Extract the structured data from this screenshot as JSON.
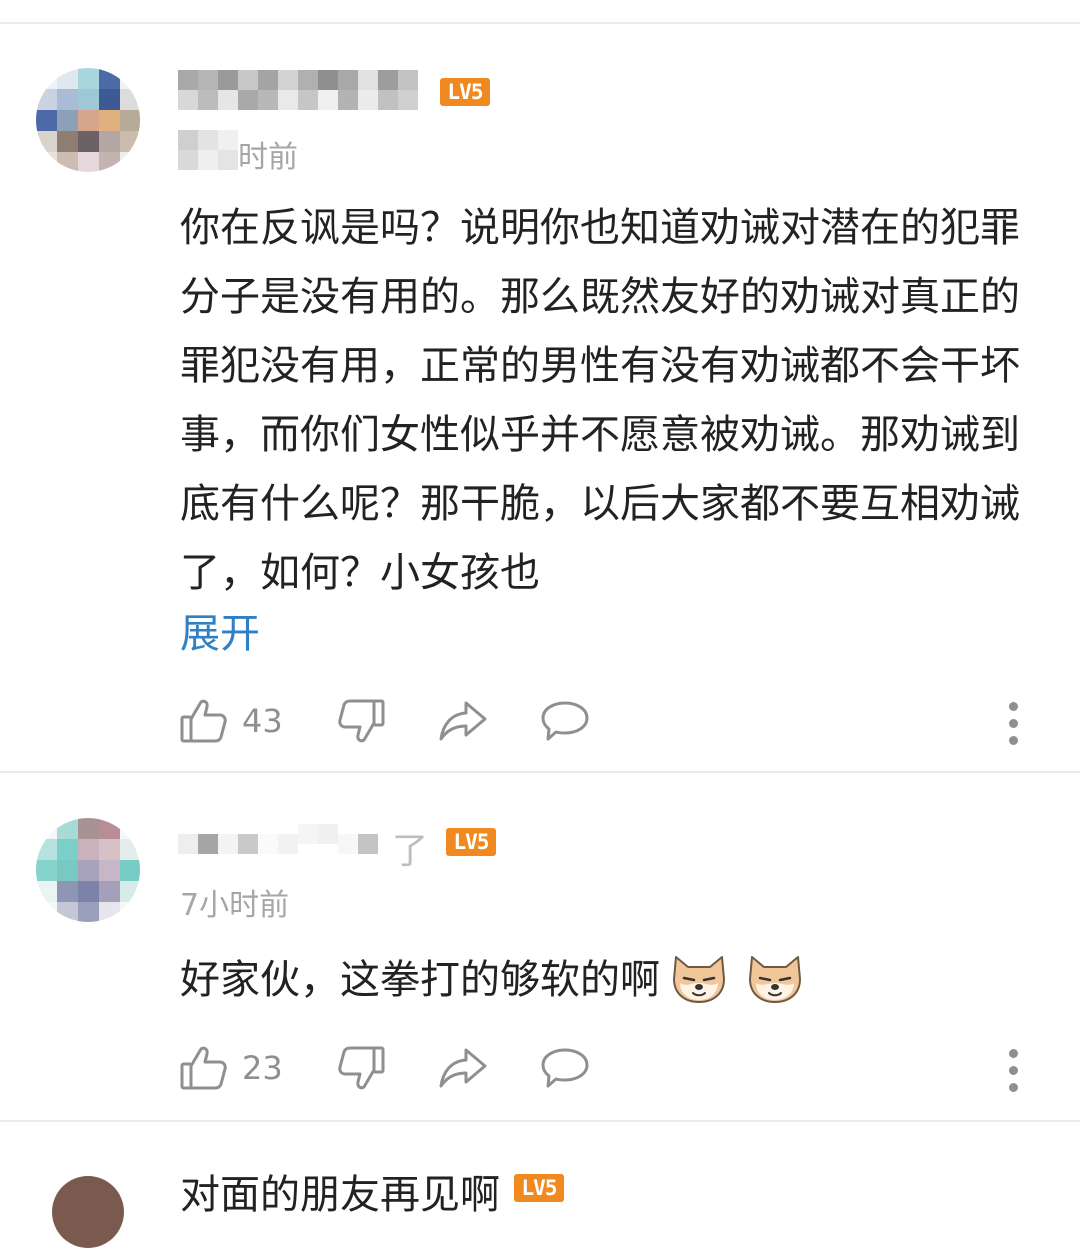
{
  "comments": [
    {
      "level_badge": "LV5",
      "time_suffix": "时前",
      "text": "你在反讽是吗？说明你也知道劝诫对潜在的犯罪分子是没有用的。那么既然友好的劝诫对真正的罪犯没有用，正常的男性有没有劝诫都不会干坏事，而你们女性似乎并不愿意被劝诫。那劝诫到底有什么呢？那干脆，以后大家都不要互相劝诫了，如何？小女孩也",
      "expand_label": "展开",
      "like_count": "43",
      "icons": [
        "thumbs-up-icon",
        "thumbs-down-icon",
        "share-icon",
        "comment-icon",
        "more-icon"
      ]
    },
    {
      "name_visible_suffix": "了",
      "level_badge": "LV5",
      "time": "7小时前",
      "text": "好家伙，这拳打的够软的啊",
      "emojis": [
        "doge-icon",
        "doge-icon"
      ],
      "like_count": "23",
      "icons": [
        "thumbs-up-icon",
        "thumbs-down-icon",
        "share-icon",
        "comment-icon",
        "more-icon"
      ]
    }
  ],
  "next_comment_partial": {
    "name": "对面的朋友再见啊",
    "level_badge": "LV5"
  },
  "colors": {
    "accent_link": "#2f81c5",
    "level_badge": "#f08a20",
    "meta_text": "#a6a6a6",
    "icon": "#8f8f8f"
  }
}
